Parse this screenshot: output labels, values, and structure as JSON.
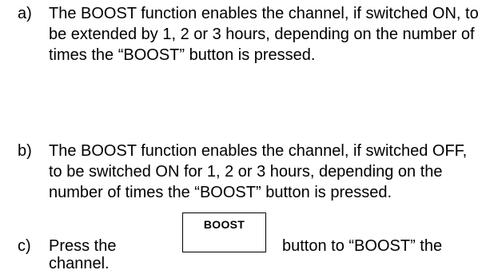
{
  "items": [
    {
      "marker": "a)",
      "text": "The BOOST function enables the channel, if switched ON, to be extended by 1, 2 or 3 hours, depending on the number of times the “BOOST” button is pressed."
    },
    {
      "marker": "b)",
      "text": "The BOOST function enables the channel, if switched OFF, to be switched ON for 1, 2 or 3 hours, depending on the number of times the “BOOST” button is pressed."
    },
    {
      "marker": "c)",
      "text_before": "Press the",
      "button_label": "BOOST",
      "text_after": "button to “BOOST” the",
      "text_continuation": "channel."
    }
  ]
}
